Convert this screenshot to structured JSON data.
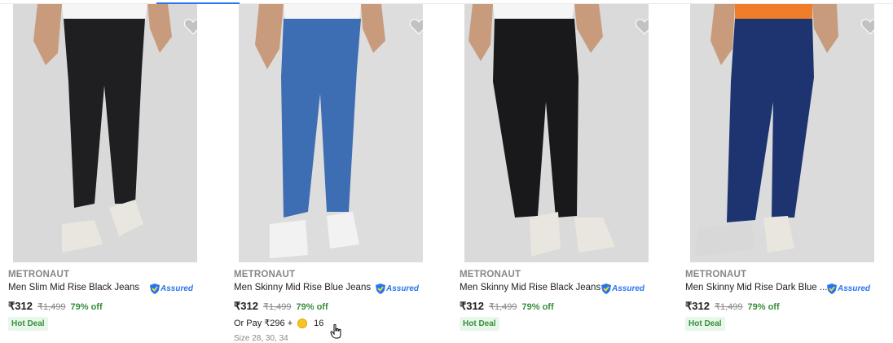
{
  "products": [
    {
      "brand": "METRONAUT",
      "title": "Men Slim Mid Rise Black Jeans",
      "assured": "Assured",
      "price": "₹312",
      "mrp": "₹1,499",
      "discount": "79% off",
      "deal": "Hot Deal",
      "jeans_color": "#1f1f22",
      "shirt_color": "#f5f5f5"
    },
    {
      "brand": "METRONAUT",
      "title": "Men Skinny Mid Rise Blue Jeans",
      "assured": "Assured",
      "price": "₹312",
      "mrp": "₹1,499",
      "discount": "79% off",
      "or_pay": "Or Pay ₹296 +",
      "coins": "16",
      "sizes": "Size 28, 30, 34",
      "jeans_color": "#3d6db3",
      "shirt_color": "#f5f5f5"
    },
    {
      "brand": "METRONAUT",
      "title": "Men Skinny Mid Rise Black Jeans",
      "assured": "Assured",
      "price": "₹312",
      "mrp": "₹1,499",
      "discount": "79% off",
      "deal": "Hot Deal",
      "jeans_color": "#19191b",
      "shirt_color": "#f5f5f5"
    },
    {
      "brand": "METRONAUT",
      "title": "Men Skinny Mid Rise Dark Blue ...",
      "assured": "Assured",
      "price": "₹312",
      "mrp": "₹1,499",
      "discount": "79% off",
      "deal": "Hot Deal",
      "jeans_color": "#1d3470",
      "shirt_color": "#f07d2a"
    }
  ],
  "colors": {
    "accent": "#2874f0",
    "discount": "#388e3c",
    "muted": "#878787"
  }
}
